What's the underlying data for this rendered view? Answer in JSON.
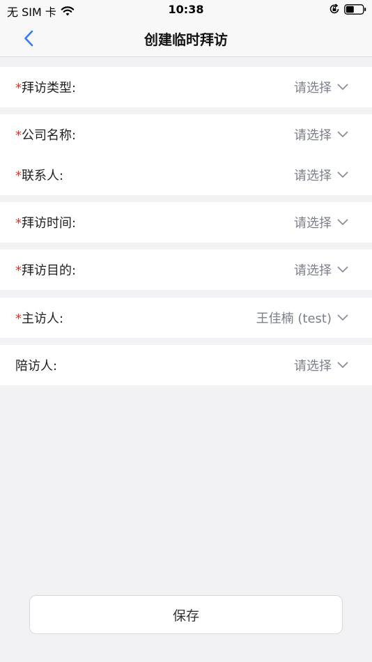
{
  "status": {
    "carrier": "无 SIM 卡",
    "time": "10:38"
  },
  "nav": {
    "title": "创建临时拜访"
  },
  "form": {
    "rows": [
      {
        "label": "拜访类型:",
        "required": true,
        "value": "请选择"
      },
      {
        "label": "公司名称:",
        "required": true,
        "value": "请选择"
      },
      {
        "label": "联系人:",
        "required": true,
        "value": "请选择"
      },
      {
        "label": "拜访时间:",
        "required": true,
        "value": "请选择"
      },
      {
        "label": "拜访目的:",
        "required": true,
        "value": "请选择"
      },
      {
        "label": "主访人:",
        "required": true,
        "value": "王佳楠 (test)"
      },
      {
        "label": "陪访人:",
        "required": false,
        "value": "请选择"
      }
    ],
    "required_mark": "*"
  },
  "footer": {
    "save_label": "保存"
  },
  "colors": {
    "accent": "#2f7cf6",
    "required": "#e0352b",
    "placeholder": "#7b7f8a",
    "background": "#f2f2f4"
  }
}
